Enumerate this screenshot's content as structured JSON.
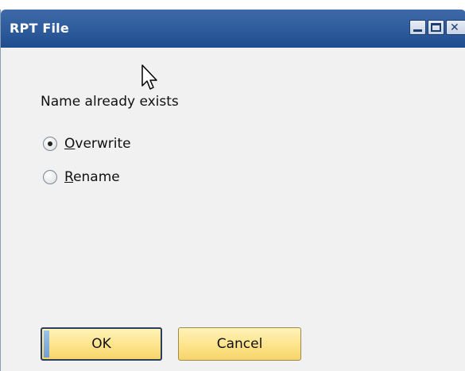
{
  "window": {
    "title": "RPT File"
  },
  "titlebar_controls": {
    "minimize_icon": "minimize-icon",
    "maximize_icon": "maximize-icon",
    "close_icon": "close-icon",
    "close_glyph": "✕"
  },
  "dialog": {
    "message": "Name already exists",
    "options": [
      {
        "label": "Overwrite",
        "mnemonic": "O",
        "rest": "verwrite",
        "selected": true
      },
      {
        "label": "Rename",
        "mnemonic": "R",
        "rest": "ename",
        "selected": false
      }
    ]
  },
  "buttons": {
    "ok_label": "OK",
    "cancel_label": "Cancel"
  },
  "colors": {
    "titlebar": "#2e5c9c",
    "button_fill": "#fde38a",
    "window_bg": "#f1f1f1"
  }
}
